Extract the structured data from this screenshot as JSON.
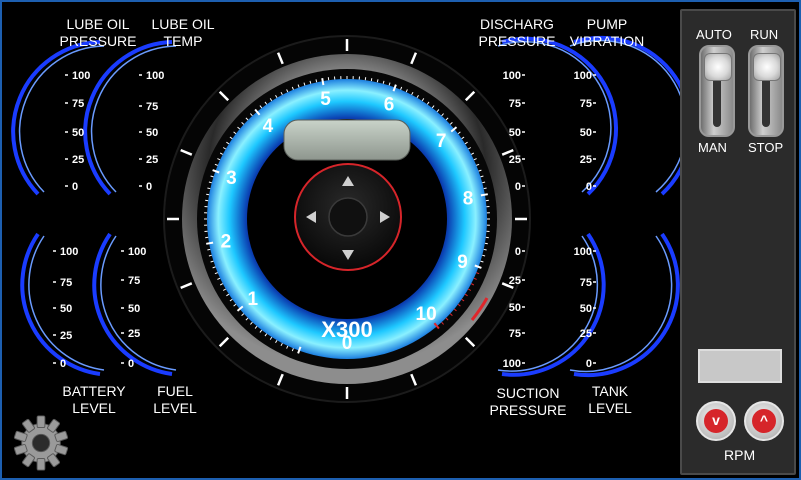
{
  "gauges": {
    "lube_oil_pressure": {
      "title1": "LUBE OIL",
      "title2": "PRESSURE",
      "ticks": [
        "100",
        "75",
        "50",
        "25",
        "0"
      ]
    },
    "lube_oil_temp": {
      "title1": "LUBE OIL",
      "title2": "TEMP",
      "ticks": [
        "100",
        "75",
        "50",
        "25",
        "0"
      ]
    },
    "battery_level": {
      "title1": "BATTERY",
      "title2": "LEVEL",
      "ticks": [
        "100",
        "75",
        "50",
        "25",
        "0"
      ]
    },
    "fuel_level": {
      "title1": "FUEL",
      "title2": "LEVEL",
      "ticks": [
        "100",
        "75",
        "50",
        "25",
        "0"
      ]
    },
    "discharge_pressure": {
      "title1": "DISCHARG",
      "title2": "PRESSURE",
      "ticks": [
        "100",
        "75",
        "50",
        "25",
        "0"
      ]
    },
    "pump_vibration": {
      "title1": "PUMP",
      "title2": "VIBRATION",
      "ticks": [
        "100",
        "75",
        "50",
        "25",
        "0"
      ]
    },
    "suction_pressure": {
      "title1": "SUCTION",
      "title2": "PRESSURE",
      "ticks": [
        "0",
        "25",
        "50",
        "75",
        "100"
      ]
    },
    "tank_level": {
      "title1": "TANK",
      "title2": "LEVEL",
      "ticks": [
        "100",
        "75",
        "50",
        "25",
        "0"
      ]
    }
  },
  "tachometer": {
    "dial_numbers": [
      "0",
      "1",
      "2",
      "3",
      "4",
      "5",
      "6",
      "7",
      "8",
      "9",
      "10"
    ],
    "multiplier": "X300",
    "accent": "#1ec8ff",
    "redline": "#e0262b"
  },
  "dpad_icons": [
    "arrow-up-icon",
    "arrow-down-icon",
    "arrow-left-icon",
    "arrow-right-icon"
  ],
  "controls": {
    "auto_label": "AUTO",
    "man_label": "MAN",
    "run_label": "RUN",
    "stop_label": "STOP",
    "rpm_label": "RPM",
    "rpm_down": "v",
    "rpm_up": "^",
    "rpm_display_value": ""
  },
  "settings_icon": "gear-icon"
}
